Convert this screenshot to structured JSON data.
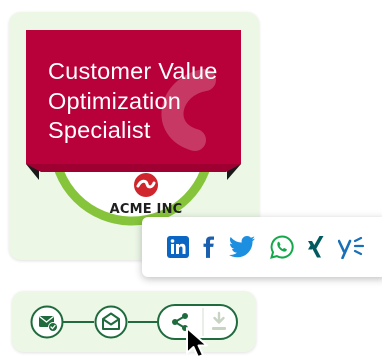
{
  "badge": {
    "title_lines": [
      "Customer Value",
      "Optimization",
      "Specialist"
    ],
    "issuer_name": "ACME INC",
    "colors": {
      "banner": "#b8003a",
      "ring": "#86c43b",
      "card": "#ecf7e6",
      "step_green": "#1f6b3d",
      "logo_red": "#d0252c"
    }
  },
  "share": {
    "networks": [
      {
        "name": "LinkedIn",
        "icon": "linkedin-icon",
        "color": "#0a66c2"
      },
      {
        "name": "Facebook",
        "icon": "facebook-icon",
        "color": "#1a5fb0"
      },
      {
        "name": "Twitter",
        "icon": "twitter-icon",
        "color": "#1d8fe0"
      },
      {
        "name": "WhatsApp",
        "icon": "whatsapp-icon",
        "color": "#14a84a"
      },
      {
        "name": "Xing",
        "icon": "xing-icon",
        "color": "#005a5f"
      },
      {
        "name": "Yammer",
        "icon": "yammer-icon",
        "color": "#1970b8"
      }
    ]
  },
  "steps": {
    "items": [
      {
        "icon": "mail-check-icon",
        "state": "done"
      },
      {
        "icon": "open-mail-icon",
        "state": "done"
      },
      {
        "icon": "share-icon",
        "state": "active"
      },
      {
        "icon": "download-icon",
        "state": "inactive"
      }
    ]
  },
  "cursor": {
    "icon": "mouse-pointer-icon"
  }
}
